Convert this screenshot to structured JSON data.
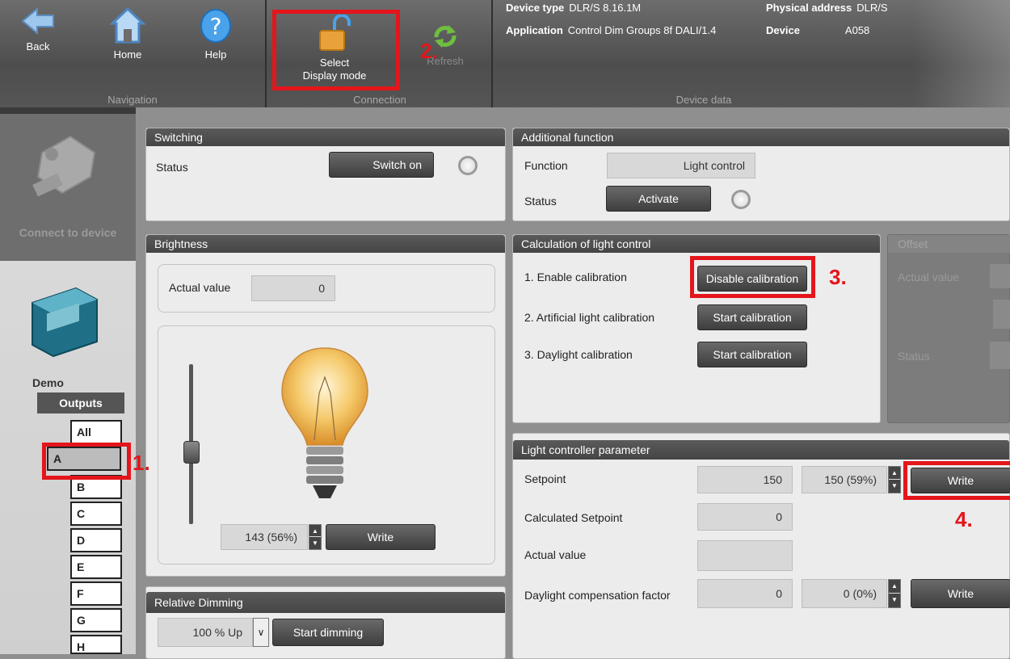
{
  "toolbar": {
    "navigation": {
      "label": "Navigation",
      "back": "Back",
      "home": "Home",
      "help": "Help"
    },
    "connection": {
      "label": "Connection",
      "select_line1": "Select",
      "select_line2": "Display mode",
      "refresh": "Refresh"
    },
    "device_data": {
      "label": "Device data",
      "device_type_label": "Device type",
      "device_type_value": "DLR/S 8.16.1M",
      "application_label": "Application",
      "application_value": "Control Dim Groups 8f DALI/1.4",
      "physical_address_label": "Physical address",
      "physical_address_value": "DLR/S",
      "device_label": "Device",
      "device_value": "A058"
    }
  },
  "sidebar": {
    "connect_label": "Connect to device",
    "demo_label": "Demo",
    "outputs_header": "Outputs",
    "outputs": [
      "All",
      "A",
      "B",
      "C",
      "D",
      "E",
      "F",
      "G",
      "H"
    ],
    "selected": "A"
  },
  "switching": {
    "title": "Switching",
    "status_label": "Status",
    "switch_button": "Switch on"
  },
  "brightness": {
    "title": "Brightness",
    "actual_label": "Actual value",
    "actual_value": "0",
    "slider_level": 0.44,
    "write_value": "143 (56%)",
    "write_button": "Write"
  },
  "relative_dimming": {
    "title": "Relative Dimming",
    "select_value": "100 % Up",
    "start_button": "Start dimming"
  },
  "additional_function": {
    "title": "Additional function",
    "function_label": "Function",
    "function_value": "Light control",
    "status_label": "Status",
    "activate_button": "Activate"
  },
  "calibration": {
    "title": "Calculation of light control",
    "row1_label": "1. Enable calibration",
    "row1_button": "Disable calibration",
    "row2_label": "2. Artificial light calibration",
    "row2_button": "Start calibration",
    "row3_label": "3. Daylight calibration",
    "row3_button": "Start calibration"
  },
  "offset": {
    "title": "Offset",
    "actual_label": "Actual value",
    "status_label": "Status"
  },
  "light_controller": {
    "title": "Light controller parameter",
    "setpoint_label": "Setpoint",
    "setpoint_value": "150",
    "setpoint_input": "150 (59%)",
    "setpoint_write": "Write",
    "calc_setpoint_label": "Calculated Setpoint",
    "calc_setpoint_value": "0",
    "actual_label": "Actual value",
    "actual_value": "",
    "daylight_label": "Daylight compensation factor",
    "daylight_value": "0",
    "daylight_input": "0 (0%)",
    "daylight_write": "Write"
  },
  "annotations": {
    "n1": "1.",
    "n2": "2.",
    "n3": "3.",
    "n4": "4."
  },
  "colors": {
    "highlight": "#e4151b",
    "lamp_glow": "#f5c96a",
    "panel_header": "#4a4a4a"
  }
}
